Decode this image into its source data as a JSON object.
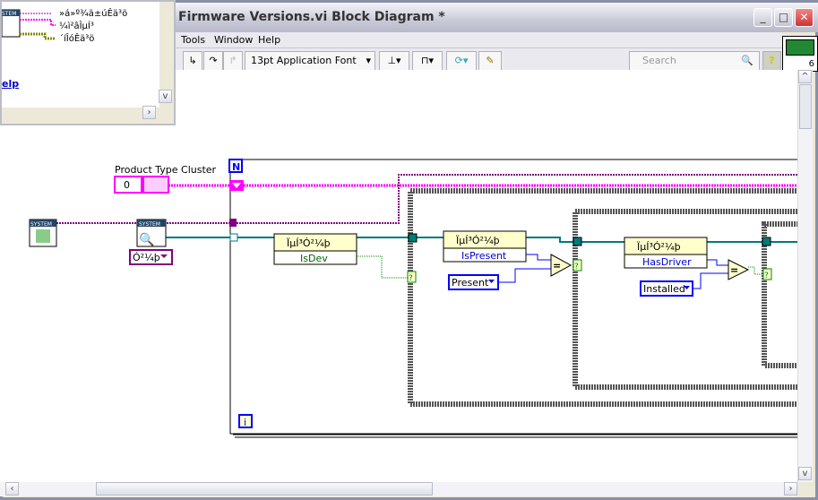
{
  "window": {
    "title": "Firmware Versions.vi Block Diagram *",
    "minimize": "_",
    "maximize": "□",
    "close": "✕"
  },
  "menu": {
    "items": [
      "Tools",
      "Window",
      "Help"
    ]
  },
  "toolbar": {
    "font": "13pt Application Font",
    "search_placeholder": "Search",
    "help": "?",
    "icon_number": "6"
  },
  "context_help": {
    "outputs": [
      "»á»º¾ä±úÊä³ö",
      "¼ì²âÎµÍ³",
      "´íÎóÊä³ö"
    ],
    "system_badge": "STEM",
    "link": "elp"
  },
  "diagram": {
    "cluster_label": "Product Type Cluster",
    "cluster_value": "0",
    "system_badge": "SYSTEM",
    "hardware_ring": "Ó²¼þ",
    "loop_count": "N",
    "loop_index": "i",
    "node_title": "ÏµÍ³Ó²¼þ",
    "prop_isdev": "IsDev",
    "prop_ispresent": "IsPresent",
    "prop_hasdriver": "HasDriver",
    "const_present": "Present",
    "const_installed": "Installed",
    "equal": "=",
    "selector": "?"
  },
  "colors": {
    "cluster_wire": "#ff00ff",
    "refnum_wire": "#007b7b",
    "enum_wire": "#0000ff",
    "bool_wire": "#008000",
    "error_wire": "#800080"
  }
}
